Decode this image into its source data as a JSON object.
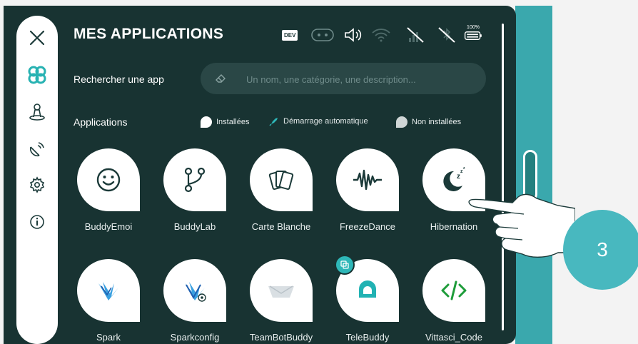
{
  "header": {
    "title": "MES APPLICATIONS"
  },
  "status_bar": {
    "dev_badge": "DEV",
    "battery_label": "100%"
  },
  "search": {
    "label": "Rechercher une app",
    "placeholder": "Un nom, une catégorie, une description..."
  },
  "applications_section": {
    "label": "Applications",
    "legend": [
      {
        "label": "Installées",
        "icon": "installed-dot"
      },
      {
        "label": "Démarrage automatique",
        "icon": "rocket-icon"
      },
      {
        "label": "Non installées",
        "icon": "not-installed-dot"
      }
    ]
  },
  "apps": [
    {
      "name": "BuddyEmoi",
      "icon": "smiley-icon"
    },
    {
      "name": "BuddyLab",
      "icon": "branch-icon"
    },
    {
      "name": "Carte Blanche",
      "icon": "cards-icon"
    },
    {
      "name": "FreezeDance",
      "icon": "soundwave-icon"
    },
    {
      "name": "Hibernation",
      "icon": "moon-sleep-icon"
    },
    {
      "name": "Spark",
      "icon": "spark-logo-icon"
    },
    {
      "name": "Sparkconfig",
      "icon": "spark-config-icon"
    },
    {
      "name": "TeamBotBuddy",
      "icon": "teambot-icon"
    },
    {
      "name": "TeleBuddy",
      "icon": "telebuddy-icon"
    },
    {
      "name": "Vittasci_Code",
      "icon": "code-icon"
    }
  ],
  "tutorial": {
    "step_number": "3"
  },
  "colors": {
    "screen_bg": "#183332",
    "accent": "#2eb7b8",
    "step_circle": "#48b8bf"
  }
}
